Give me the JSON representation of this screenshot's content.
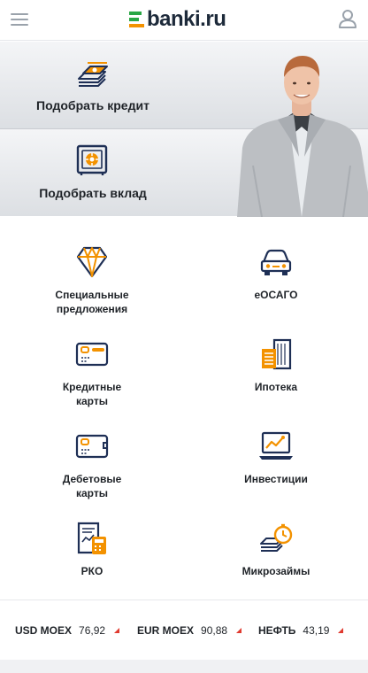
{
  "header": {
    "logo_text": "banki.ru"
  },
  "hero": {
    "credit_label": "Подобрать кредит",
    "deposit_label": "Подобрать вклад"
  },
  "services": [
    {
      "label": "Специальные\nпредложения",
      "icon": "diamond-icon"
    },
    {
      "label": "еОСАГО",
      "icon": "car-icon"
    },
    {
      "label": "Кредитные\nкарты",
      "icon": "credit-card-icon"
    },
    {
      "label": "Ипотека",
      "icon": "building-icon"
    },
    {
      "label": "Дебетовые\nкарты",
      "icon": "debit-card-icon"
    },
    {
      "label": "Инвестиции",
      "icon": "laptop-chart-icon"
    },
    {
      "label": "РКО",
      "icon": "calculator-document-icon"
    },
    {
      "label": "Микрозаймы",
      "icon": "money-clock-icon"
    }
  ],
  "ticker": [
    {
      "name": "USD MOEX",
      "value": "76,92",
      "trend": "up"
    },
    {
      "name": "EUR MOEX",
      "value": "90,88",
      "trend": "up"
    },
    {
      "name": "НЕФТЬ",
      "value": "43,19",
      "trend": "up"
    }
  ],
  "colors": {
    "accent_orange": "#f39200",
    "icon_navy": "#1e2f55",
    "logo_green": "#29a645",
    "trend_red": "#e03a2f"
  }
}
